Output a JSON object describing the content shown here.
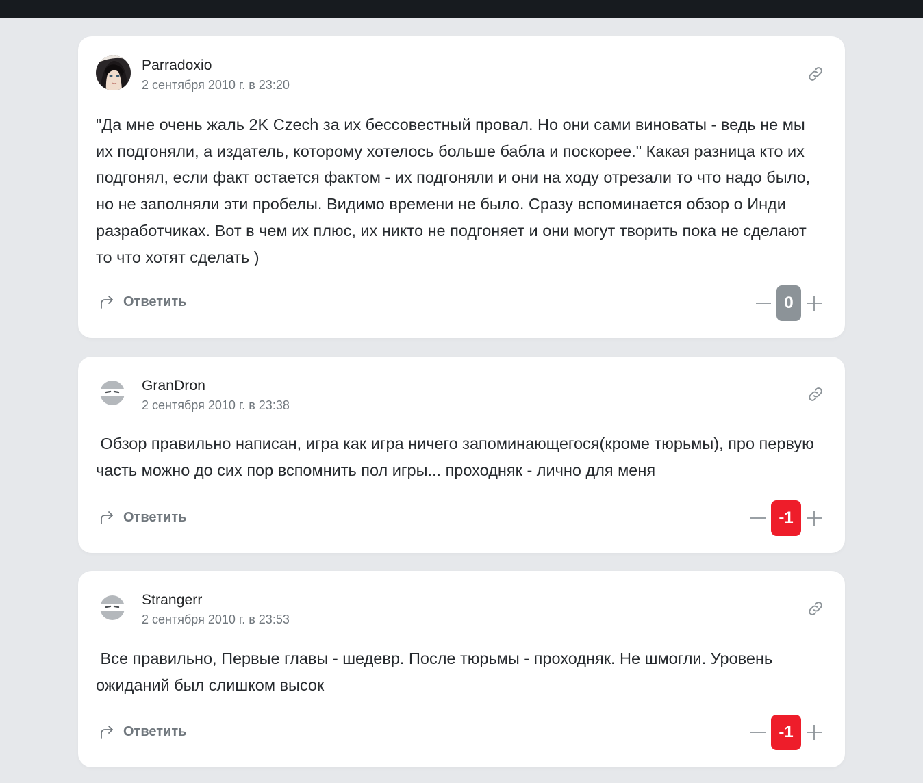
{
  "colors": {
    "page_bg": "#e6e8eb",
    "card_bg": "#ffffff",
    "score_neutral": "#8c9398",
    "score_negative": "#ee1d2a",
    "muted_text": "#70777d"
  },
  "comments": [
    {
      "author": "Parradoxio",
      "date": "2 сентября 2010 г. в 23:20",
      "avatar": "user-photo-avatar",
      "text": "\"Да мне очень жаль 2K Czech за их бессовестный провал. Но они сами виноваты - ведь не мы их подгоняли, а издатель, которому хотелось больше бабла и поскорее.\" Какая разница кто их подгонял, если факт остается фактом - их подгоняли и они на ходу отрезали то что надо было, но не заполняли эти пробелы. Видимо времени не было. Сразу вспоминается обзор о Инди разработчиках. Вот в чем их плюс, их никто не подгоняет и они могут творить пока не сделают то что хотят сделать )",
      "reply_label": "Ответить",
      "score": "0",
      "score_color": "#8c9398"
    },
    {
      "author": "GranDron",
      "date": "2 сентября 2010 г. в 23:38",
      "avatar": "default-ninja-avatar",
      "text": " Обзор правильно написан, игра как игра ничего запоминающегося(кроме тюрьмы), про первую часть можно до сих пор вспомнить пол игры... проходняк - лично для меня",
      "reply_label": "Ответить",
      "score": "-1",
      "score_color": "#ee1d2a"
    },
    {
      "author": "Strangerr",
      "date": "2 сентября 2010 г. в 23:53",
      "avatar": "default-ninja-avatar",
      "text": " Все правильно, Первые главы - шедевр. После тюрьмы - проходняк. Не шмогли. Уровень ожиданий был слишком высок",
      "reply_label": "Ответить",
      "score": "-1",
      "score_color": "#ee1d2a"
    }
  ]
}
